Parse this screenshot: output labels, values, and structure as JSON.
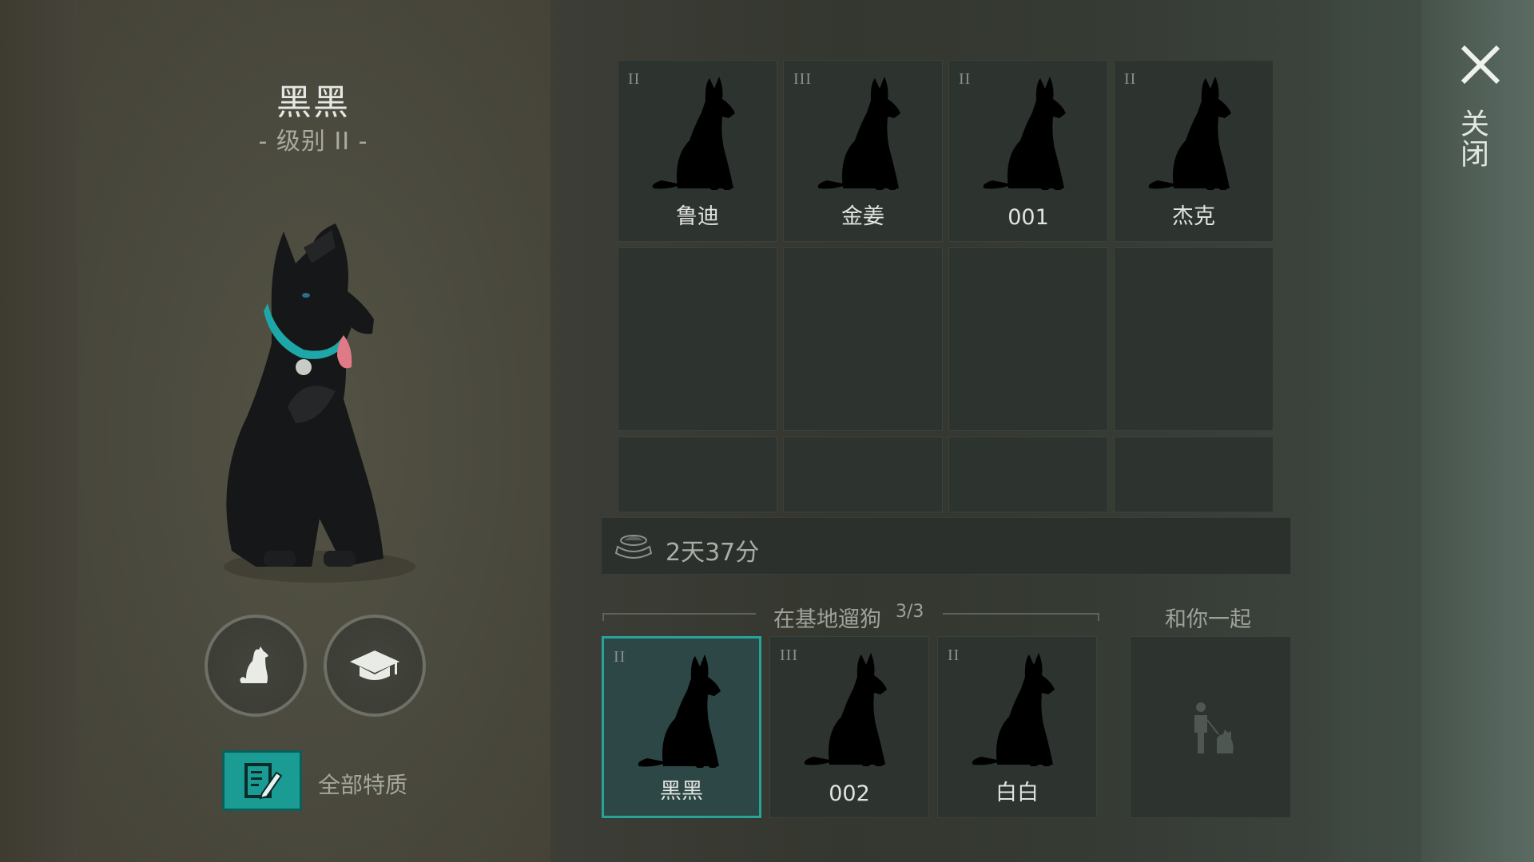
{
  "selected_dog": {
    "name": "黑黑",
    "level_text": "- 级别 II -"
  },
  "actions": {
    "pet_icon": "sitting-dog-icon",
    "training_icon": "graduation-cap-icon",
    "traits_icon": "edit-document-icon",
    "traits_label": "全部特质"
  },
  "kennel": {
    "slots": [
      {
        "tier": "II",
        "name": "鲁迪",
        "coat": "tan",
        "collar": "#3b6fd0"
      },
      {
        "tier": "III",
        "name": "金姜",
        "coat": "tan",
        "collar": "#c0392b"
      },
      {
        "tier": "II",
        "name": "001",
        "coat": "tan",
        "collar": "#3b6fd0"
      },
      {
        "tier": "II",
        "name": "杰克",
        "coat": "tan",
        "collar": "#3b6fd0"
      }
    ]
  },
  "food": {
    "icon": "dog-bowl-icon",
    "time_left": "2天37分"
  },
  "base_walk": {
    "title": "在基地遛狗",
    "count": "3/3",
    "dogs": [
      {
        "tier": "II",
        "name": "黑黑",
        "coat": "black",
        "collar": "#3b6fd0",
        "selected": true
      },
      {
        "tier": "III",
        "name": "002",
        "coat": "tan",
        "collar": "#3b6fd0",
        "selected": false
      },
      {
        "tier": "II",
        "name": "白白",
        "coat": "white",
        "collar": "#c0392b",
        "selected": false
      }
    ]
  },
  "with_you": {
    "title": "和你一起",
    "icon": "person-with-dog-icon"
  },
  "close": {
    "icon": "close-icon",
    "label": "关闭"
  },
  "colors": {
    "accent": "#1a9c94",
    "selected_border": "#26a49b"
  }
}
